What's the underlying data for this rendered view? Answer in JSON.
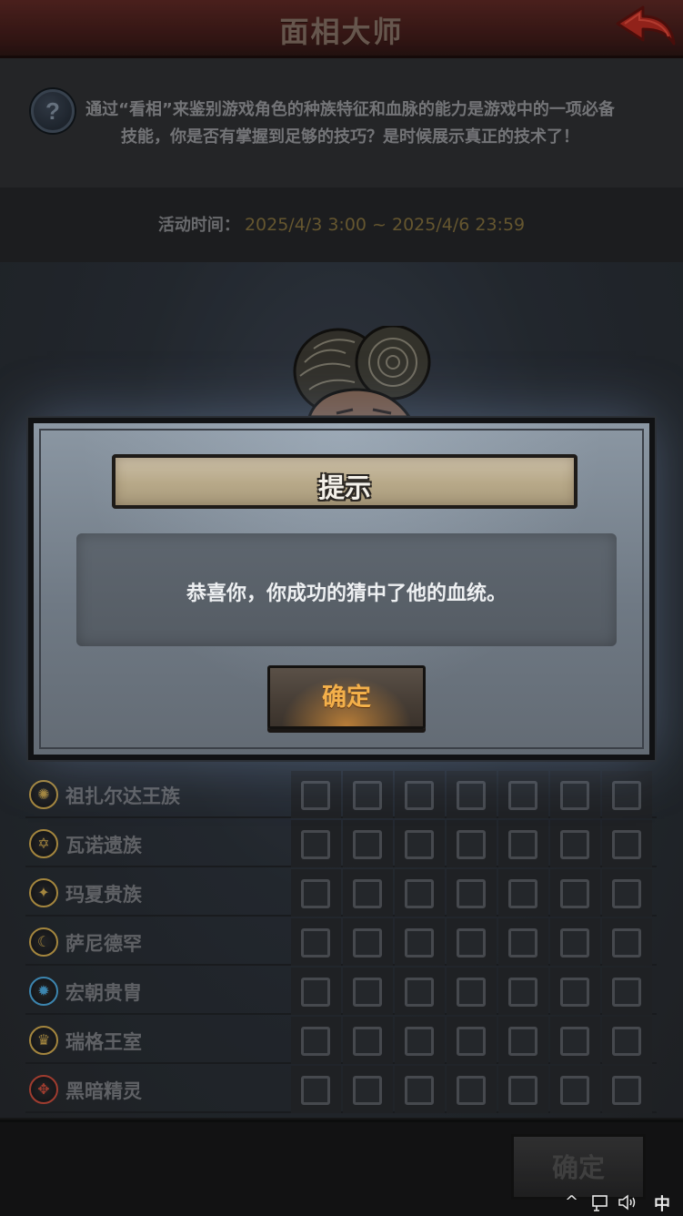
{
  "header": {
    "title": "面相大师",
    "back_icon": "back-arrow-icon"
  },
  "description": {
    "help_icon": "question-mark-icon",
    "help_glyph": "?",
    "text": "通过“看相”来鉴别游戏角色的种族特征和血脉的能力是游戏中的一项必备技能，你是否有掌握到足够的技巧？是时候展示真正的技术了！"
  },
  "activity": {
    "label": "活动时间：",
    "value": "2025/4/3 3:00 ~ 2025/4/6 23:59"
  },
  "lineages": [
    {
      "name": "祖扎尔达王族",
      "icon": "zuzarda-crest-icon",
      "glyph": "✺",
      "color": "#c9a44c"
    },
    {
      "name": "瓦诺遗族",
      "icon": "vano-crest-icon",
      "glyph": "✡",
      "color": "#c9a44c"
    },
    {
      "name": "玛夏贵族",
      "icon": "masha-crest-icon",
      "glyph": "✦",
      "color": "#c9a44c"
    },
    {
      "name": "萨尼德罕",
      "icon": "sanidehan-crest-icon",
      "glyph": "☾",
      "color": "#c9a44c"
    },
    {
      "name": "宏朝贵胄",
      "icon": "hongchao-crest-icon",
      "glyph": "✹",
      "color": "#4aa3d6"
    },
    {
      "name": "瑞格王室",
      "icon": "ruige-crest-icon",
      "glyph": "♛",
      "color": "#c9a44c"
    },
    {
      "name": "黑暗精灵",
      "icon": "dark-elf-crest-icon",
      "glyph": "✥",
      "color": "#c24a3a"
    }
  ],
  "grid": {
    "columns": 7
  },
  "bottom": {
    "confirm_label": "确定"
  },
  "dialog": {
    "title": "提示",
    "message": "恭喜你，你成功的猜中了他的血统。",
    "confirm_label": "确定"
  },
  "taskbar": {
    "chevron": "^",
    "network_icon": "network-icon",
    "volume_icon": "volume-icon",
    "ime_label": "中"
  }
}
